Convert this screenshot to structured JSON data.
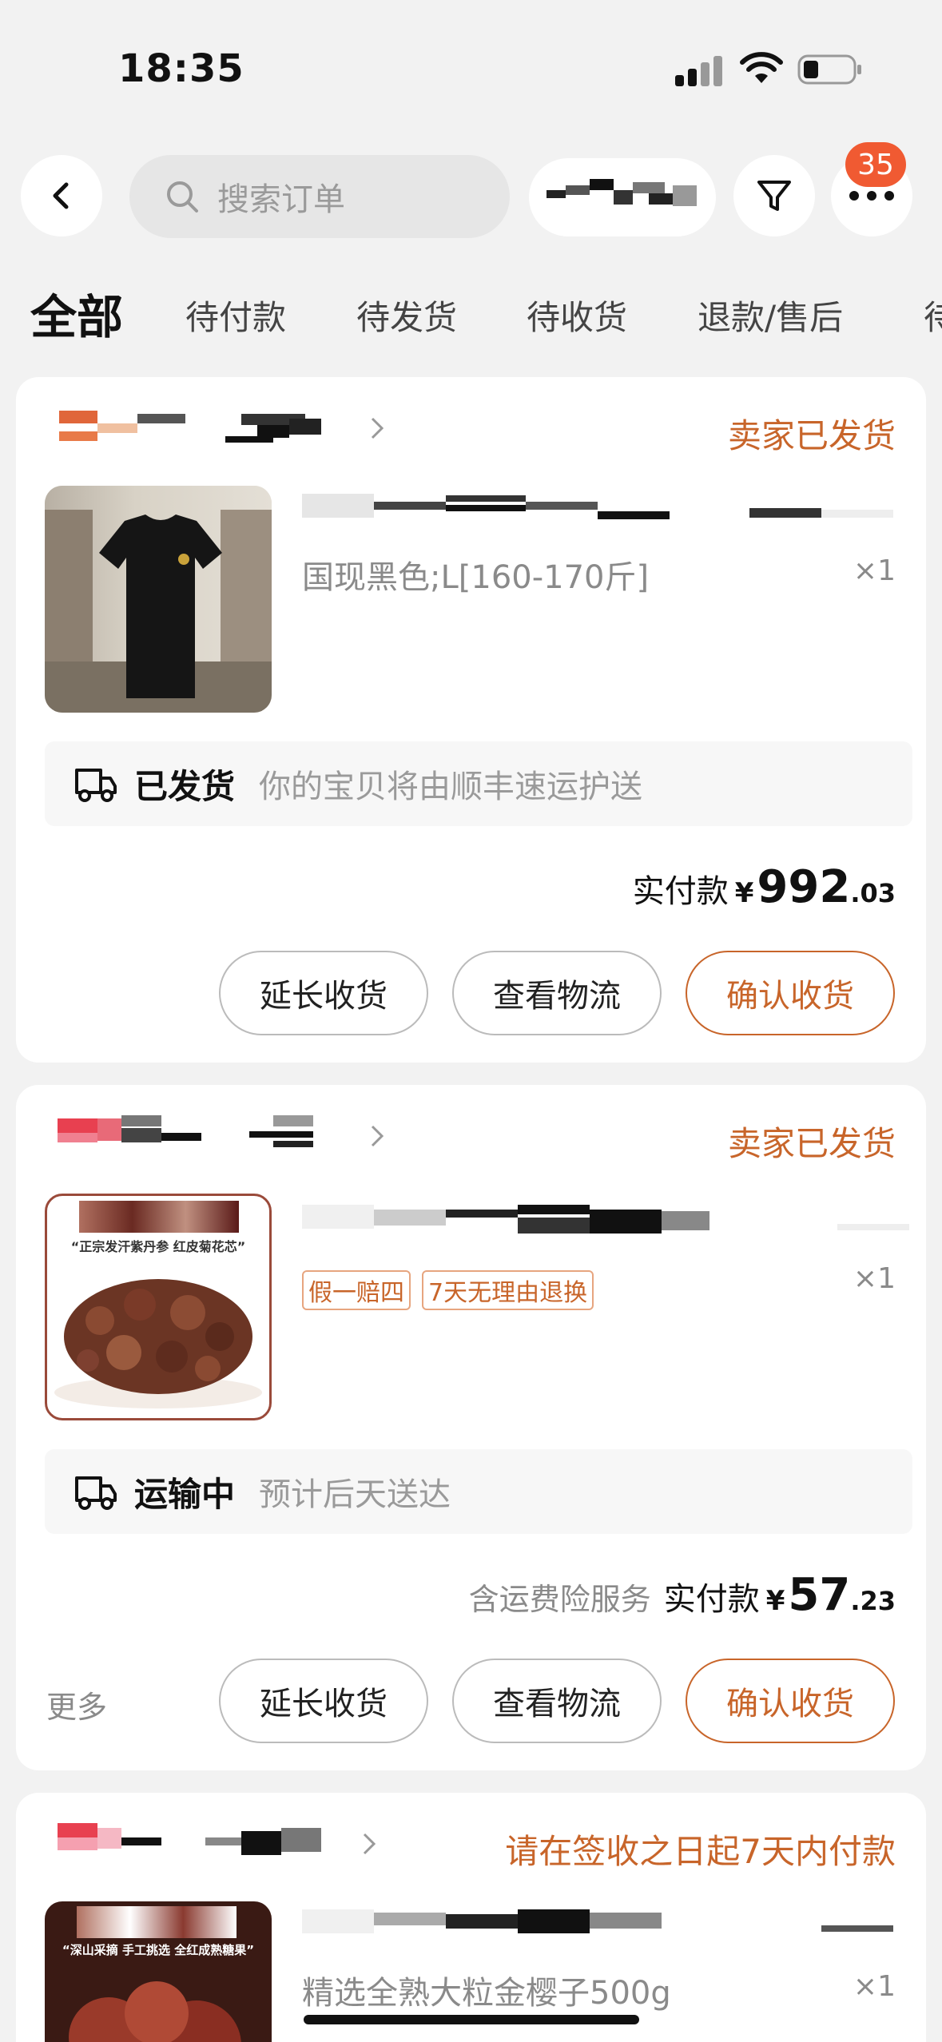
{
  "status_bar": {
    "time": "18:35"
  },
  "search": {
    "placeholder": "搜索订单"
  },
  "notification_badge": "35",
  "tabs": [
    "全部",
    "待付款",
    "待发货",
    "待收货",
    "退款/售后",
    "待"
  ],
  "colors": {
    "accent": "#c8652a",
    "badge": "#f05a32",
    "background": "#f2f2f2"
  },
  "orders": [
    {
      "status": "卖家已发货",
      "spec": "国现黑色;L[160-170斤]",
      "qty": "×1",
      "shipping_label": "已发货",
      "shipping_desc": "你的宝贝将由顺丰速运护送",
      "pay_label": "实付款",
      "currency": "¥",
      "amount_int": "992",
      "amount_dec": ".03",
      "buttons": [
        "延长收货",
        "查看物流",
        "确认收货"
      ]
    },
    {
      "status": "卖家已发货",
      "tags": [
        "假一赔四",
        "7天无理由退换"
      ],
      "qty": "×1",
      "thumb_text": "“正宗发汗紫丹参 红皮菊花芯”",
      "shipping_label": "运输中",
      "shipping_desc": "预计后天送达",
      "pay_note": "含运费险服务",
      "pay_label": "实付款",
      "currency": "¥",
      "amount_int": "57",
      "amount_dec": ".23",
      "more": "更多",
      "buttons": [
        "延长收货",
        "查看物流",
        "确认收货"
      ]
    },
    {
      "status": "请在签收之日起7天内付款",
      "spec": "精选全熟大粒金樱子500g",
      "qty": "×1",
      "thumb_text": "“深山采摘 手工挑选 全红成熟糖果”"
    }
  ]
}
